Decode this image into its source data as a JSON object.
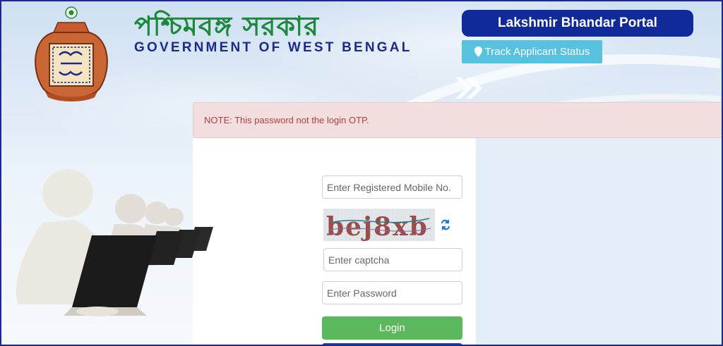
{
  "header": {
    "title_bengali": "পশ্চিমবঙ্গ সরকার",
    "title_english": "GOVERNMENT OF WEST BENGAL",
    "logo_icon": "lakshmir-bhandar-pot-logo"
  },
  "nav": {
    "portal_label": "Lakshmir Bhandar Portal",
    "track_label": "Track Applicant Status",
    "track_icon": "map-marker-icon"
  },
  "notice": {
    "text": "NOTE: This password not the login OTP."
  },
  "login_form": {
    "mobile_placeholder": "Enter Registered Mobile No.",
    "mobile_value": "",
    "captcha_text": "bej8xb",
    "captcha_placeholder": "Enter captcha",
    "captcha_value": "",
    "password_placeholder": "Enter Password",
    "password_value": "",
    "login_label": "Login"
  },
  "colors": {
    "brand_blue": "#112a9a",
    "title_green": "#1a8a3a",
    "track_cyan": "#56c2e0",
    "login_green": "#5cb85c",
    "note_bg": "#f2dede",
    "note_text": "#b0403e"
  }
}
